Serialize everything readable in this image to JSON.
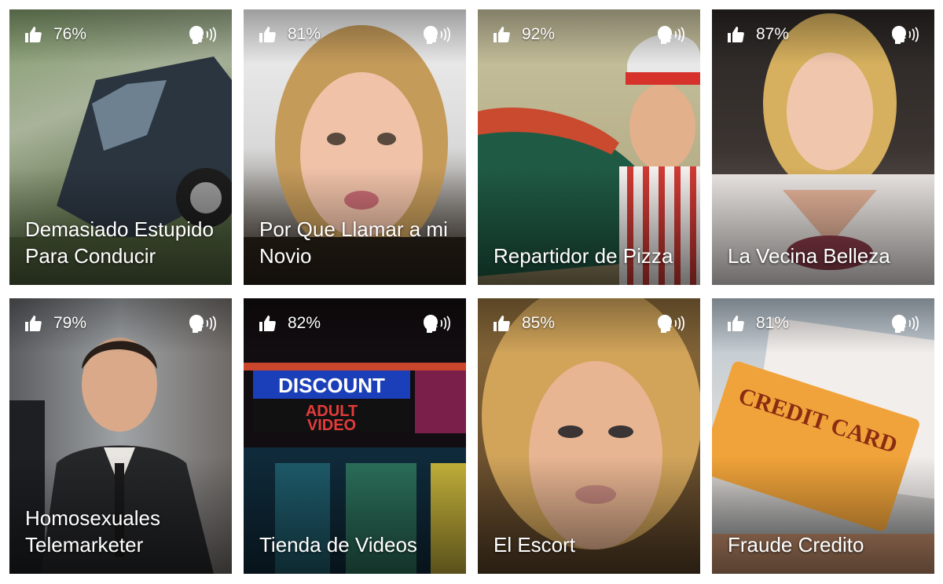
{
  "tiles": [
    {
      "percent": "76%",
      "title": "Demasiado Estupido Para Conducir"
    },
    {
      "percent": "81%",
      "title": "Por Que Llamar a mi Novio"
    },
    {
      "percent": "92%",
      "title": "Repartidor de Pizza"
    },
    {
      "percent": "87%",
      "title": "La Vecina Belleza"
    },
    {
      "percent": "79%",
      "title": "Homosexuales Telemarketer"
    },
    {
      "percent": "82%",
      "title": "Tienda de Videos"
    },
    {
      "percent": "85%",
      "title": "El Escort"
    },
    {
      "percent": "81%",
      "title": "Fraude Credito"
    }
  ],
  "photo_texts": {
    "discount": "DISCOUNT",
    "adult_video_1": "ADULT",
    "adult_video_2": "VIDEO",
    "credit_card": "CREDIT CARD"
  },
  "icons": {
    "like": "thumbs-up-icon",
    "voice": "speaking-head-icon"
  },
  "colors": {
    "text": "#ffffff",
    "background": "#ffffff"
  }
}
